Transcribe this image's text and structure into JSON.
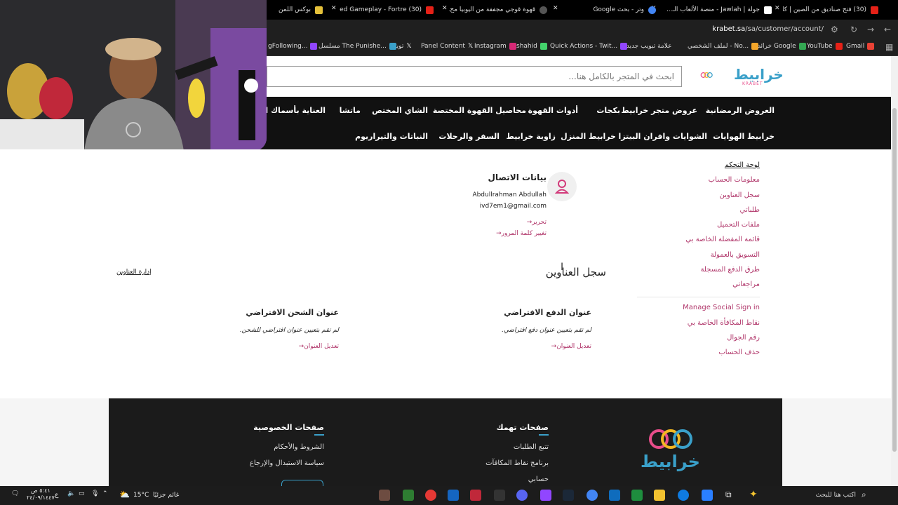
{
  "tabs": [
    {
      "label": "(30) فتح صناديق من الصين | كا...",
      "color": "#e62117"
    },
    {
      "label": "جولة | Jawlah - منصة الألعاب الـ...",
      "color": "#ffffff"
    },
    {
      "label": "وتر - بحث Google",
      "color": "#4285f4"
    },
    {
      "label": "قهوة قوجي مجففة من اليوبيا مح...",
      "color": "#777777"
    },
    {
      "label": "(30) Enlisted Gameplay - Fortre...",
      "color": "#e62117"
    },
    {
      "label": "بوكس اللمن",
      "color": "#e5c13a"
    }
  ],
  "address": {
    "domain": "krabet.sa",
    "path": "/sa/customer/account/"
  },
  "bookmarks": [
    {
      "label": "Gmail",
      "color": "#e94235"
    },
    {
      "label": "YouTube",
      "color": "#e62117"
    },
    {
      "label": "خرائط Google",
      "color": "#34a853"
    },
    {
      "label": "لملف الشخصي - No...",
      "color": "#f4a62a"
    },
    {
      "label": "علامة تبويب جديدة",
      "color": "#777777"
    },
    {
      "label": "Quick Actions - Twit...",
      "color": "#9146ff"
    },
    {
      "label": "shahid",
      "color": "#43d36b"
    },
    {
      "label": "Instagram",
      "color": "#d62976"
    },
    {
      "label": "Panel Content",
      "color": "#ffffff"
    },
    {
      "label": "تويتر",
      "color": "#ffffff"
    },
    {
      "label": "مسلسل The Punishe...",
      "color": "#3aa0c9"
    },
    {
      "label": "gFollowing...",
      "color": "#9146ff"
    }
  ],
  "search": {
    "placeholder": "ابحث في المتجر بالكامل هنا..."
  },
  "logo": {
    "text": "خرابيط",
    "sub": "KRABET"
  },
  "nav": {
    "row1": [
      "العروض الرمضانية",
      "عروض متجر خرابيط",
      "بكجات",
      "أدوات القهوة",
      "محاصيل القهوة المختصة",
      "الشاي المختص",
      "ماتشا",
      "العناية بأسماك الز"
    ],
    "row2": [
      "خرابيط الهوايات",
      "الشوايات وافران البيتزا",
      "خرابيط المنزل",
      "زاوية خرابيط",
      "السفر والرحلات",
      "النباتات والتيراريوم"
    ]
  },
  "sidebar": {
    "items": [
      {
        "label": "لوحة التحكم",
        "active": true
      },
      {
        "label": "معلومات الحساب"
      },
      {
        "label": "سجل العناوين"
      },
      {
        "label": "طلباتي"
      },
      {
        "label": "ملفات التحميل"
      },
      {
        "label": "قائمة المفضلة الخاصة بي"
      },
      {
        "label": "التسويق بالعمولة"
      },
      {
        "label": "طرق الدفع المسجلة"
      },
      {
        "label": "مراجعاتي"
      }
    ],
    "items2": [
      {
        "label": "Manage Social Sign in"
      },
      {
        "label": "نقاط المكافأة الخاصة بي"
      },
      {
        "label": "رقم الجوال"
      },
      {
        "label": "حذف الحساب"
      }
    ]
  },
  "contact": {
    "title": "بيانات الاتصال",
    "name": "Abdullrahman Abdullah",
    "email": "ivd7em1@gmail.com",
    "edit": "تحرير",
    "change_password": "تغيير كلمة المرور"
  },
  "address_book": {
    "title": "سجل العناوين",
    "manage": "إدارة العناوين",
    "billing_title": "عنوان الدفع الافتراضي",
    "billing_text": "لم تقم بتعيين عنوان دفع افتراضي.",
    "billing_edit": "تعديل العنوان",
    "shipping_title": "عنوان الشحن الافتراضي",
    "shipping_text": "لم تقم بتعيين عنوان افتراضي للشحن.",
    "shipping_edit": "تعديل العنوان"
  },
  "footer": {
    "logo_text": "خرابيط",
    "col1_title": "صفحات تهمك",
    "col1_links": [
      "تتبع الطلبات",
      "برنامج نقاط المكافآت",
      "حسابي"
    ],
    "col2_title": "صفحات الخصوصية",
    "col2_links": [
      "الشروط والأحكام",
      "سياسة الاستبدال والإرجاع"
    ]
  },
  "taskbar": {
    "search": "اكتب هنا للبحث",
    "weather": "غائم جزئيًا",
    "temp": "15°C",
    "time": "٥:٤١ ص",
    "date": "٢٤/٠٩/١٤٤٧",
    "lang": "ع"
  },
  "colors": {
    "brand_pink": "#b0366a",
    "brand_blue": "#3aa0c9",
    "nav_bg": "#111111",
    "footer_bg": "#1b1b1b"
  }
}
